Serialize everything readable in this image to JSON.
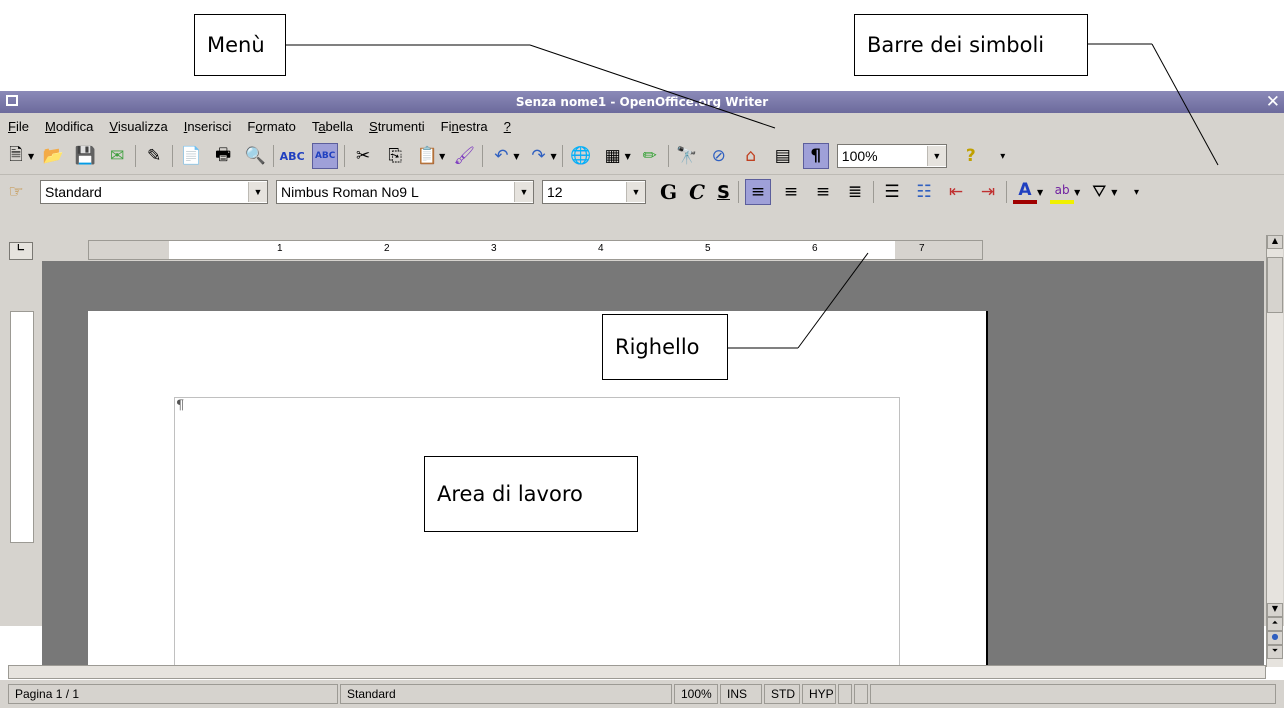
{
  "annotations": {
    "menu": "Menù",
    "toolbars": "Barre dei simboli",
    "ruler": "Righello",
    "work_area": "Area di lavoro"
  },
  "window": {
    "title": "Senza nome1 - OpenOffice.org Writer"
  },
  "menu": {
    "items": [
      {
        "u": "F",
        "rest": "ile"
      },
      {
        "u": "M",
        "rest": "odifica"
      },
      {
        "u": "V",
        "rest": "isualizza"
      },
      {
        "u": "I",
        "rest": "nserisci"
      },
      {
        "pre": "F",
        "u": "o",
        "rest": "rmato"
      },
      {
        "pre": "T",
        "u": "a",
        "rest": "bella"
      },
      {
        "u": "S",
        "rest": "trumenti"
      },
      {
        "pre": "Fi",
        "u": "n",
        "rest": "estra"
      },
      {
        "u": "?",
        "rest": ""
      }
    ]
  },
  "toolbar_standard": {
    "zoom": "100%"
  },
  "toolbar_format": {
    "paragraph_style": "Standard",
    "font_name": "Nimbus Roman No9 L",
    "font_size": "12",
    "bold": "G",
    "italic": "C",
    "underline": "S"
  },
  "ruler": {
    "numbers": [
      "1",
      "2",
      "3",
      "4",
      "5",
      "6",
      "7"
    ]
  },
  "statusbar": {
    "page": "Pagina 1 / 1",
    "style": "Standard",
    "zoom": "100%",
    "ins": "INS",
    "std": "STD",
    "hyp": "HYP"
  }
}
